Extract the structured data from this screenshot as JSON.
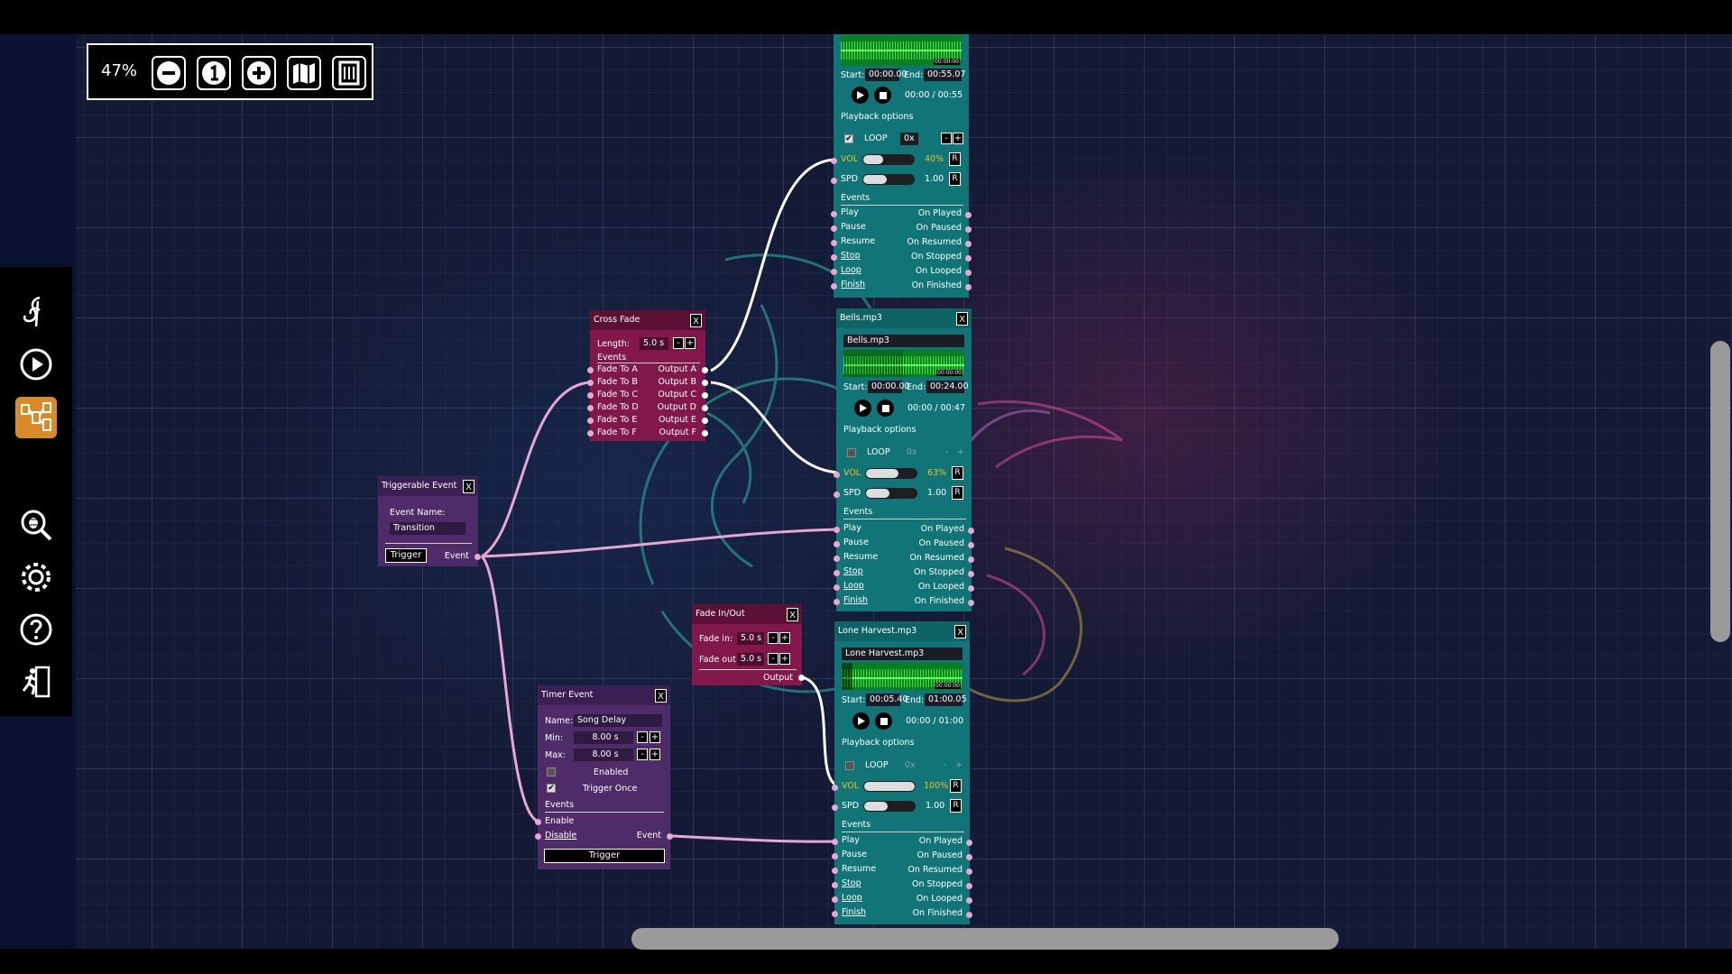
{
  "zoom": {
    "level": "47%"
  },
  "colors": {
    "canvas": "#141a36",
    "audio_node": "#117577",
    "fade_node": "#82184a",
    "event_node": "#4e2c69",
    "wire": "#e7a7d5",
    "sidebar_active": "#d98b2a",
    "volume_text": "#e6c020"
  },
  "sidebar": {
    "icons": [
      "music-note-icon",
      "play-icon",
      "node-graph-icon",
      "bug-search-icon",
      "gear-icon",
      "help-icon",
      "exit-icon"
    ]
  },
  "toolbar": {
    "icons": [
      "zoom-out-icon",
      "zoom-reset-icon",
      "zoom-in-icon",
      "map-icon",
      "fit-view-icon"
    ]
  },
  "audio_common": {
    "close": "X",
    "start_label": "Start:",
    "end_label": "End:",
    "playback_label": "Playback options",
    "loop_label": "LOOP",
    "loop_minus": "-",
    "loop_plus": "+",
    "vol_label": "VOL",
    "spd_label": "SPD",
    "reset": "R",
    "events_label": "Events",
    "inputs": [
      "Play",
      "Pause",
      "Resume",
      "Stop",
      "Loop",
      "Finish"
    ],
    "outputs": [
      "On Played",
      "On Paused",
      "On Resumed",
      "On Stopped",
      "On Looped",
      "On Finished"
    ]
  },
  "audio1": {
    "start": "00:00.00",
    "end": "00:55.07",
    "time": "00:00 / 00:55",
    "loop_count": "0x",
    "loop_checked": true,
    "vol": "40%",
    "vol_level": 0.4,
    "spd": "1.00",
    "spd_level": 0.5,
    "wave_time": "00:00:00"
  },
  "audio2": {
    "title": "Bells.mp3",
    "file": "Bells.mp3",
    "start": "00:00.00",
    "end": "00:24.00",
    "time": "00:00 / 00:47",
    "loop_count": "0x",
    "loop_checked": false,
    "vol": "63%",
    "vol_level": 0.63,
    "spd": "1.00",
    "spd_level": 0.5,
    "wave_time": "00:00:00"
  },
  "audio3": {
    "title": "Lone Harvest.mp3",
    "file": "Lone Harvest.mp3",
    "start": "00:05.40",
    "end": "01:00.05",
    "time": "00:00 / 01:00",
    "loop_count": "0x",
    "loop_checked": false,
    "vol": "100%",
    "vol_level": 1.0,
    "spd": "1.00",
    "spd_level": 0.5,
    "wave_time": "00:00:00"
  },
  "crossfade": {
    "title": "Cross Fade",
    "close": "X",
    "length_label": "Length:",
    "length": "5.0 s",
    "minus": "-",
    "plus": "+",
    "events_label": "Events",
    "inputs": [
      "Fade To A",
      "Fade To B",
      "Fade To C",
      "Fade To D",
      "Fade To E",
      "Fade To F"
    ],
    "outputs": [
      "Output A",
      "Output B",
      "Output C",
      "Output D",
      "Output E",
      "Output F"
    ]
  },
  "trigger": {
    "title": "Triggerable Event",
    "close": "X",
    "name_label": "Event Name:",
    "name": "Transition",
    "button": "Trigger",
    "event_label": "Event"
  },
  "fade": {
    "title": "Fade In/Out",
    "close": "X",
    "in_label": "Fade in:",
    "in": "5.0 s",
    "out_label": "Fade out:",
    "out": "5.0 s",
    "minus": "-",
    "plus": "+",
    "output_label": "Output"
  },
  "timer": {
    "title": "Timer Event",
    "close": "X",
    "name_label": "Name:",
    "name": "Song Delay",
    "min_label": "Min:",
    "min": "8.00 s",
    "max_label": "Max:",
    "max": "8.00 s",
    "minus": "-",
    "plus": "+",
    "enabled_label": "Enabled",
    "enabled": false,
    "once_label": "Trigger Once",
    "once": true,
    "events_label": "Events",
    "enable": "Enable",
    "disable": "Disable",
    "event_label": "Event",
    "button": "Trigger"
  }
}
